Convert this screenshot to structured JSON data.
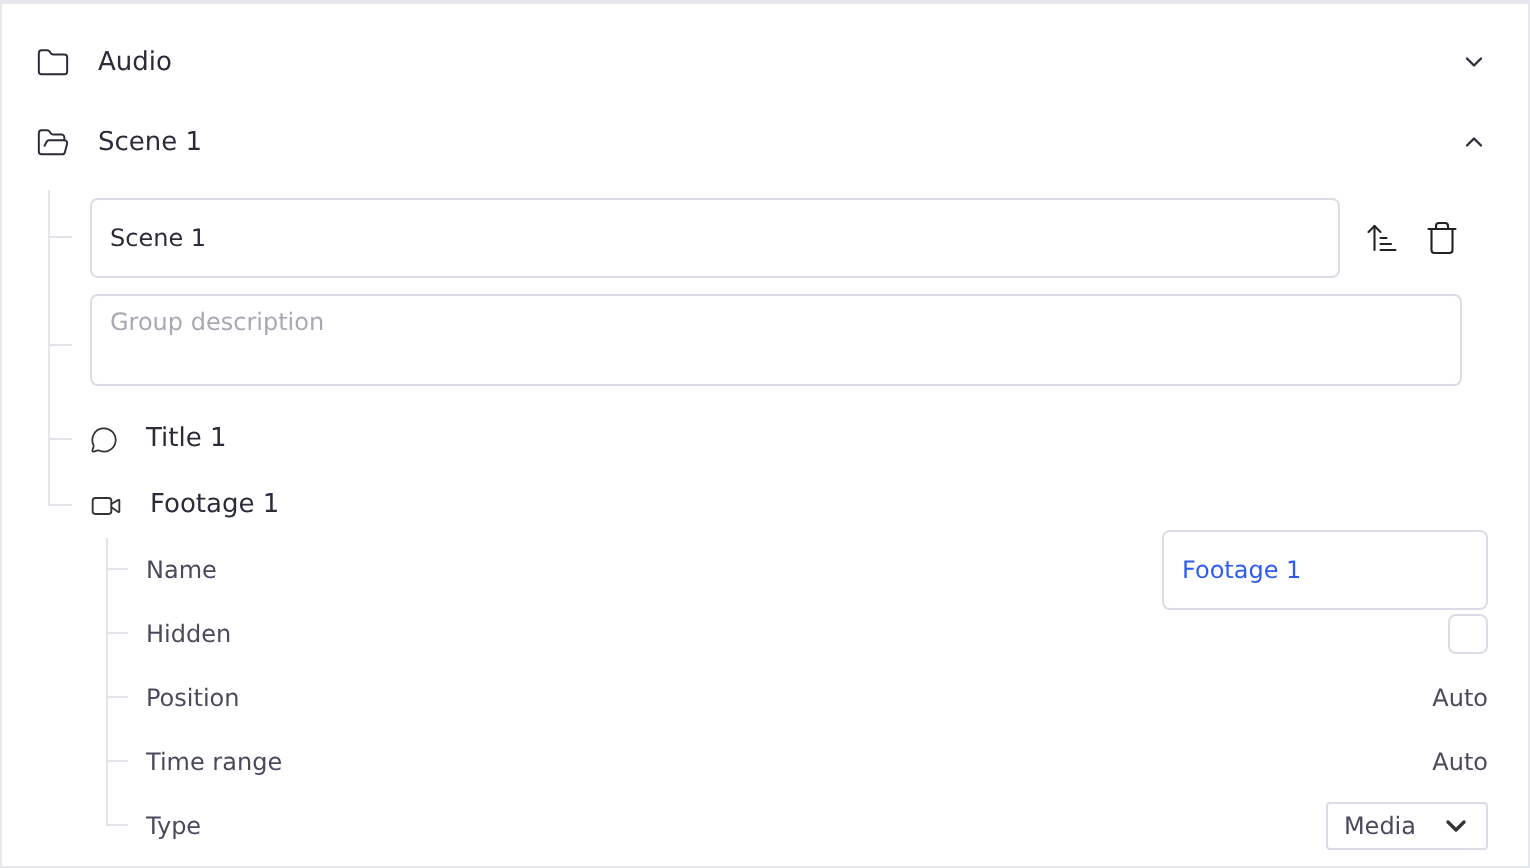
{
  "groups": [
    {
      "name": "Audio",
      "expanded": false
    },
    {
      "name": "Scene 1",
      "expanded": true,
      "name_field": {
        "value": "Scene 1"
      },
      "description_field": {
        "placeholder": "Group description"
      },
      "items": [
        {
          "kind": "title",
          "label": "Title 1"
        },
        {
          "kind": "footage",
          "label": "Footage 1",
          "properties": [
            {
              "kind": "text",
              "label": "Name",
              "value": "Footage 1",
              "focused": true
            },
            {
              "kind": "checkbox",
              "label": "Hidden",
              "checked": false
            },
            {
              "kind": "value",
              "label": "Position",
              "value": "Auto"
            },
            {
              "kind": "value",
              "label": "Time range",
              "value": "Auto"
            },
            {
              "kind": "select",
              "label": "Type",
              "value": "Media"
            }
          ]
        }
      ]
    }
  ]
}
